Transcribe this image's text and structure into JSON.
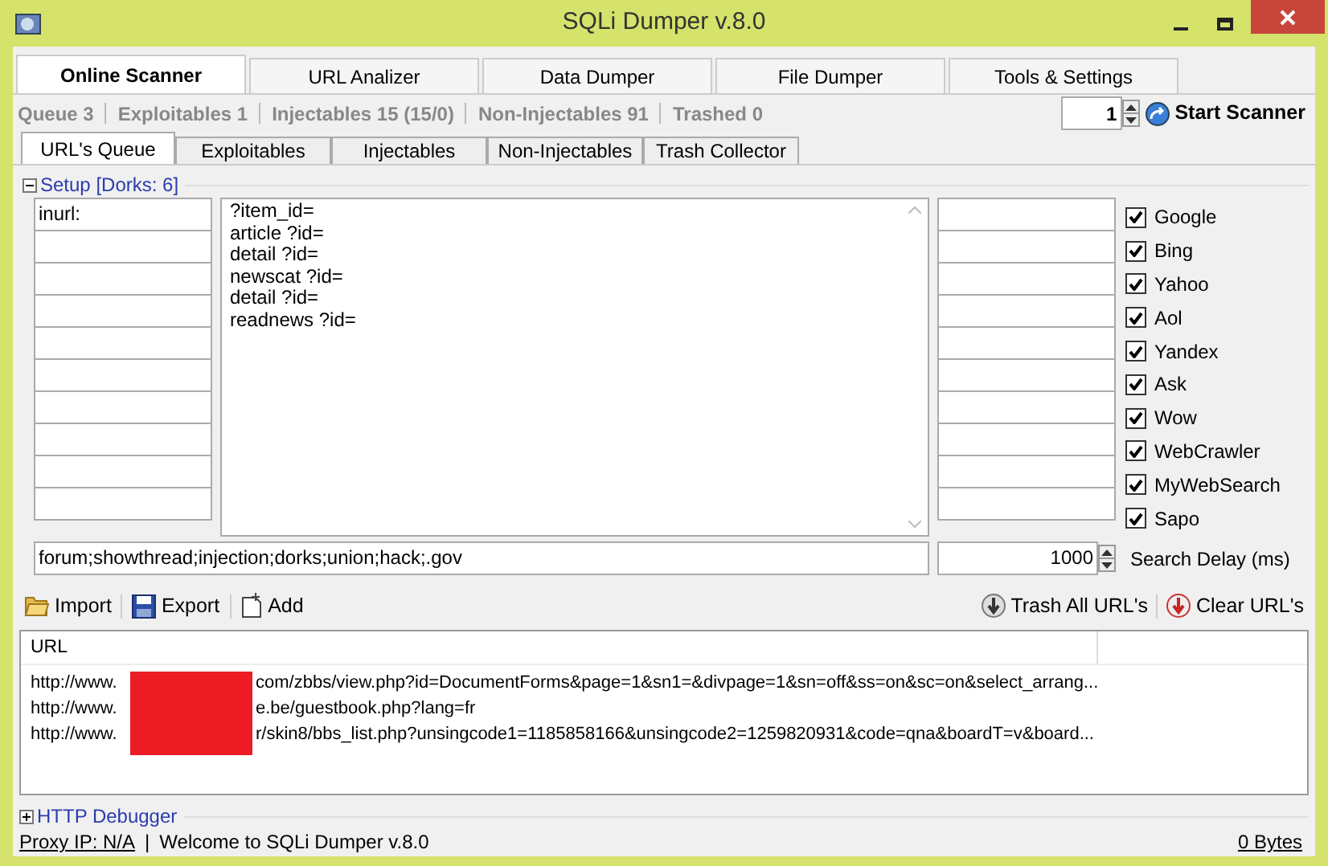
{
  "window": {
    "title": "SQLi Dumper v.8.0"
  },
  "main_tabs": [
    {
      "label": "Online Scanner",
      "selected": true
    },
    {
      "label": "URL Analizer",
      "selected": false
    },
    {
      "label": "Data Dumper",
      "selected": false
    },
    {
      "label": "File Dumper",
      "selected": false
    },
    {
      "label": "Tools & Settings",
      "selected": false
    }
  ],
  "stats": [
    "Queue 3",
    "Exploitables 1",
    "Injectables 15 (15/0)",
    "Non-Injectables 91",
    "Trashed 0"
  ],
  "threads": {
    "value": "1"
  },
  "start_button": "Start Scanner",
  "sub_tabs": [
    {
      "label": "URL's Queue",
      "selected": true
    },
    {
      "label": "Exploitables",
      "selected": false
    },
    {
      "label": "Injectables",
      "selected": false
    },
    {
      "label": "Non-Injectables",
      "selected": false
    },
    {
      "label": "Trash Collector",
      "selected": false
    }
  ],
  "setup": {
    "title": "Setup [Dorks: 6]",
    "expanded": true,
    "prefixes": [
      "inurl:"
    ],
    "dorks": [
      "?item_id=",
      "article ?id=",
      "detail ?id=",
      "newscat ?id=",
      "detail ?id=",
      "readnews ?id="
    ],
    "engines": [
      {
        "label": "Google",
        "checked": true
      },
      {
        "label": "Bing",
        "checked": true
      },
      {
        "label": "Yahoo",
        "checked": true
      },
      {
        "label": "Aol",
        "checked": true
      },
      {
        "label": "Yandex",
        "checked": true
      },
      {
        "label": "Ask",
        "checked": true
      },
      {
        "label": "Wow",
        "checked": true
      },
      {
        "label": "WebCrawler",
        "checked": true
      },
      {
        "label": "MyWebSearch",
        "checked": true
      },
      {
        "label": "Sapo",
        "checked": true
      }
    ],
    "exclude": "forum;showthread;injection;dorks;union;hack;.gov",
    "delay": "1000",
    "delay_label": "Search Delay (ms)"
  },
  "toolbar": {
    "left": [
      {
        "label": "Import",
        "kind": "import"
      },
      {
        "label": "Export",
        "kind": "export"
      },
      {
        "label": "Add",
        "kind": "add"
      }
    ],
    "right": [
      {
        "label": "Trash All URL's",
        "kind": "trash"
      },
      {
        "label": "Clear URL's",
        "kind": "clear"
      }
    ]
  },
  "url_list": {
    "column": "URL",
    "rows": [
      {
        "prefix": "http://www.",
        "suffix": "com/zbbs/view.php?id=DocumentForms&page=1&sn1=&divpage=1&sn=off&ss=on&sc=on&select_arrang..."
      },
      {
        "prefix": "http://www.",
        "suffix": "e.be/guestbook.php?lang=fr"
      },
      {
        "prefix": "http://www.",
        "suffix": "r/skin8/bbs_list.php?unsingcode1=1185858166&unsingcode2=1259820931&code=qna&boardT=v&board..."
      }
    ]
  },
  "debugger": {
    "title": "HTTP Debugger",
    "expanded": false
  },
  "status_bar": {
    "proxy": "Proxy IP: N/A",
    "separator": "|",
    "message": "Welcome to SQLi Dumper v.8.0",
    "bytes": "0 Bytes"
  }
}
